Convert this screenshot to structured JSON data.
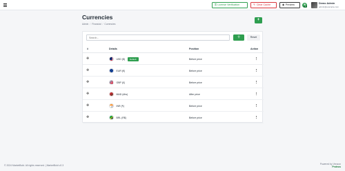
{
  "topbar": {
    "license_label": "License Verification",
    "clear_cache_label": "Clear Cache",
    "preview_label": "Preview",
    "notification_count": "1",
    "user": {
      "name": "Demo Admin",
      "email": "admin@example.com"
    }
  },
  "page": {
    "title": "Currencies",
    "add_label": "+",
    "breadcrumb": [
      "Admin",
      "Financial",
      "Currencies"
    ],
    "breadcrumb_separator": "/"
  },
  "search": {
    "placeholder": "Search...",
    "value": "",
    "reset_label": "Reset"
  },
  "table": {
    "headers": {
      "hash": "#",
      "details": "Details",
      "position": "Position",
      "action": "Action"
    },
    "default_badge": "Default",
    "rows": [
      {
        "code": "USD ($)",
        "position": "Before price",
        "is_default": true,
        "flag": "us-flag"
      },
      {
        "code": "EUR (€)",
        "position": "Before price",
        "is_default": false,
        "flag": "eu-flag"
      },
      {
        "code": "GBP (£)",
        "position": "Before price",
        "is_default": false,
        "flag": "uk-flag"
      },
      {
        "code": "MAD (dhs)",
        "position": "After price",
        "is_default": false,
        "flag": "morocco-flag"
      },
      {
        "code": "INR (₹)",
        "position": "Before price",
        "is_default": false,
        "flag": "india-flag"
      },
      {
        "code": "BRL (R$)",
        "position": "Before price",
        "is_default": false,
        "flag": "brazil-flag"
      }
    ]
  },
  "footer": {
    "copyright": "© 2024 MarketBold. All rights reserved. | MarketBold v2.3",
    "powered_by": "Powered by Venzon",
    "brand": "Proteus"
  },
  "colors": {
    "accent": "#2e9e4f",
    "danger": "#d9343a"
  }
}
